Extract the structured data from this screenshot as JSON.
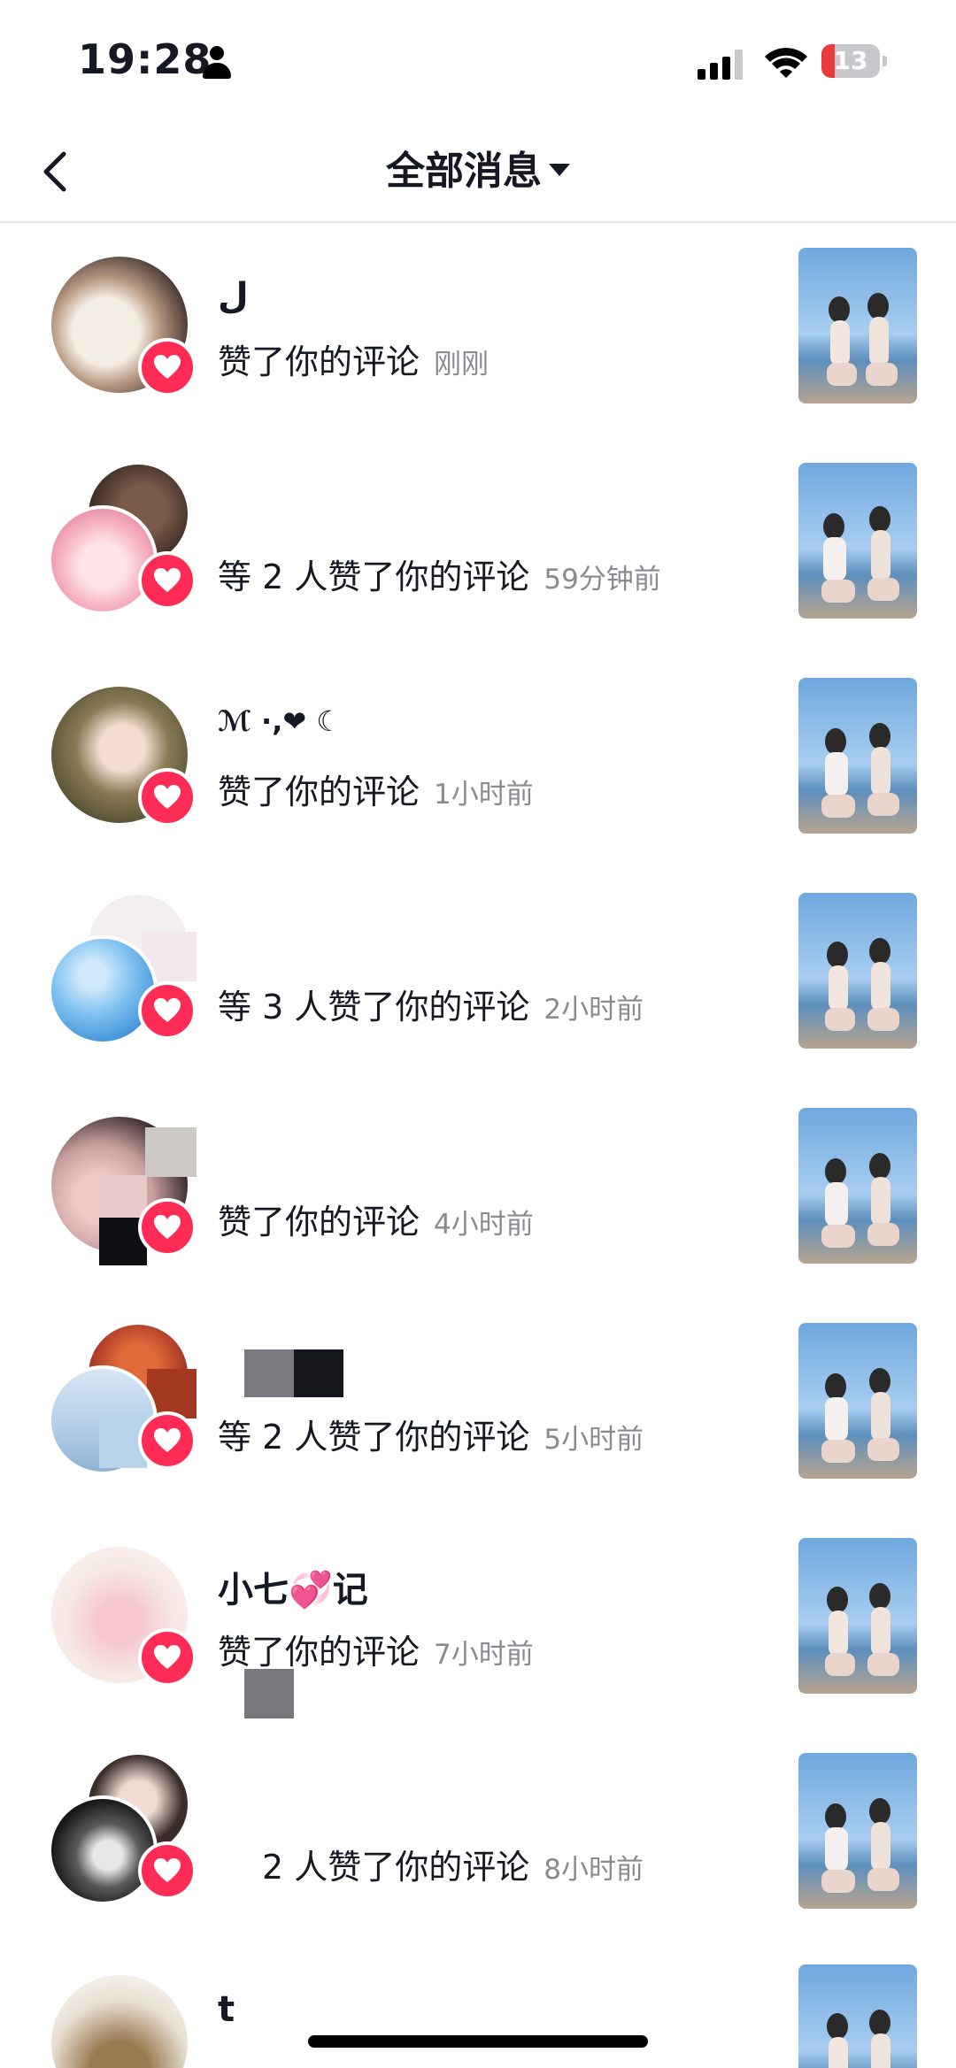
{
  "status_bar": {
    "time": "19:28",
    "battery": "13"
  },
  "nav": {
    "title": "全部消息"
  },
  "notifications": [
    {
      "name": "ل",
      "action": "赞了你的评论",
      "time": "刚刚"
    },
    {
      "name": "",
      "action": "等 2 人赞了你的评论",
      "time": "59分钟前"
    },
    {
      "name": "ℳ ·,❤ ☾",
      "action": "赞了你的评论",
      "time": "1小时前"
    },
    {
      "name": "",
      "action": "等 3 人赞了你的评论",
      "time": "2小时前"
    },
    {
      "name": "",
      "action": "赞了你的评论",
      "time": "4小时前"
    },
    {
      "name": "",
      "action": "等 2 人赞了你的评论",
      "time": "5小时前"
    },
    {
      "name": "小七💞记",
      "action": "赞了你的评论",
      "time": "7小时前"
    },
    {
      "name": "",
      "action": "2 人赞了你的评论",
      "time": "8小时前"
    },
    {
      "name": "t",
      "action": "",
      "time": ""
    }
  ],
  "colors": {
    "accent": "#fe2c55",
    "secondary_text": "#8a8b91"
  }
}
